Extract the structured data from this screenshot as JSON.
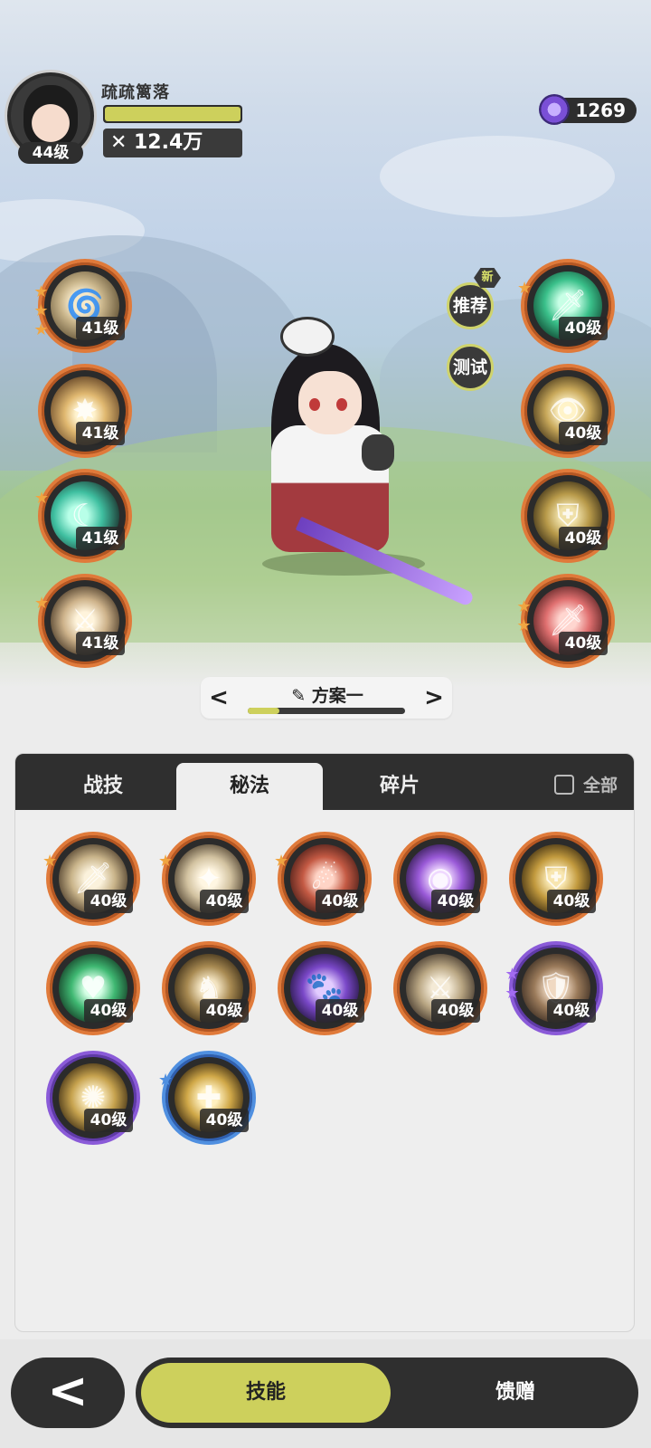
{
  "player": {
    "name": "疏疏篱落",
    "level": "44级",
    "power": "12.4万",
    "hp_fraction": 1.0
  },
  "currency": {
    "amount": "1269",
    "icon": "gem-icon"
  },
  "side_buttons": {
    "recommend": "推荐",
    "recommend_badge": "新",
    "test": "测试"
  },
  "equipped_left": [
    {
      "level": "41级",
      "stars": "★★★",
      "icon": "swirl-slash-icon"
    },
    {
      "level": "41级",
      "stars": "",
      "icon": "burst-icon"
    },
    {
      "level": "41级",
      "stars": "★",
      "icon": "crescent-wave-icon"
    },
    {
      "level": "41级",
      "stars": "★",
      "icon": "claw-strike-icon"
    }
  ],
  "equipped_right": [
    {
      "level": "40级",
      "stars": "★",
      "icon": "jade-sword-icon"
    },
    {
      "level": "40级",
      "stars": "",
      "icon": "eye-icon"
    },
    {
      "level": "40级",
      "stars": "",
      "icon": "golden-armor-icon"
    },
    {
      "level": "40级",
      "stars": "★★",
      "icon": "red-sword-heal-icon"
    }
  ],
  "scheme": {
    "title": "方案一",
    "prev": "<",
    "next": ">",
    "progress": 0.2,
    "edit_icon": "pencil-icon"
  },
  "tabs": {
    "combat": "战技",
    "secret": "秘法",
    "fragments": "碎片",
    "all": "全部"
  },
  "skills": [
    {
      "level": "40级",
      "stars": "★",
      "frame": "orange",
      "icon": "sword-up-icon"
    },
    {
      "level": "40级",
      "stars": "★",
      "frame": "orange",
      "icon": "blade-shine-icon"
    },
    {
      "level": "40级",
      "stars": "★",
      "frame": "orange",
      "icon": "red-swirl-icon"
    },
    {
      "level": "40级",
      "stars": "",
      "frame": "orange",
      "icon": "purple-orb-icon"
    },
    {
      "level": "40级",
      "stars": "",
      "frame": "orange",
      "icon": "gold-armor-icon"
    },
    {
      "level": "40级",
      "stars": "",
      "frame": "orange",
      "icon": "green-heart-icon"
    },
    {
      "level": "40级",
      "stars": "",
      "frame": "orange",
      "icon": "gold-beast-icon"
    },
    {
      "level": "40级",
      "stars": "",
      "frame": "orange",
      "icon": "purple-beast-icon"
    },
    {
      "level": "40级",
      "stars": "",
      "frame": "orange",
      "icon": "sword-down-icon"
    },
    {
      "level": "40级",
      "stars": "★★",
      "frame": "purple",
      "icon": "shield-heart-icon"
    },
    {
      "level": "40级",
      "stars": "",
      "frame": "purple",
      "icon": "vortex-icon"
    },
    {
      "level": "40级",
      "stars": "★",
      "frame": "blue",
      "icon": "heal-figure-icon"
    }
  ],
  "bottom": {
    "back": "<",
    "skills": "技能",
    "gift": "馈赠"
  },
  "colors": {
    "accent": "#cdd05c",
    "orange_frame": "#e07a3a",
    "purple_frame": "#8a5ad8",
    "blue_frame": "#4f8fe0",
    "dark": "#2f2f2f"
  }
}
